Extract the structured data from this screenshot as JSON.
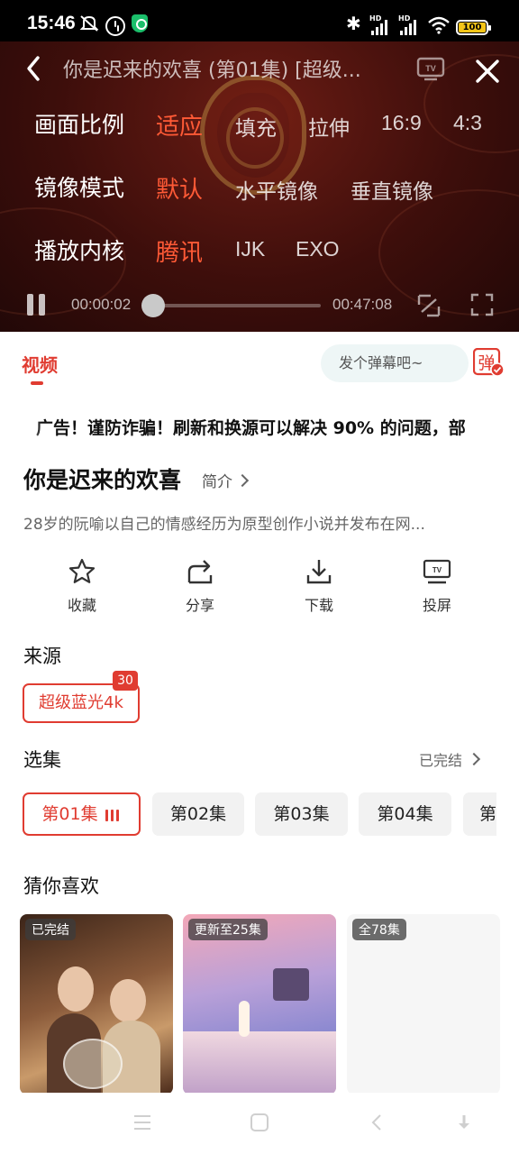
{
  "status_bar": {
    "time": "15:46",
    "battery": "100",
    "icons": [
      "mute-icon",
      "alarm-icon",
      "shield-icon",
      "bluetooth-icon",
      "signal-icon",
      "signal-icon",
      "wifi-icon",
      "battery-icon"
    ],
    "hd_labels": [
      "HD",
      "HD"
    ]
  },
  "player": {
    "title": "你是迟来的欢喜 (第01集) [超级...",
    "settings": {
      "aspect": {
        "label": "画面比例",
        "options": [
          "适应",
          "填充",
          "拉伸",
          "16:9",
          "4:3"
        ],
        "selected": "适应"
      },
      "mirror": {
        "label": "镜像模式",
        "options": [
          "默认",
          "水平镜像",
          "垂直镜像"
        ],
        "selected": "默认"
      },
      "engine": {
        "label": "播放内核",
        "options": [
          "腾讯",
          "IJK",
          "EXO"
        ],
        "selected": "腾讯"
      }
    },
    "current_time": "00:00:02",
    "total_time": "00:47:08",
    "progress": 0.001,
    "icons": [
      "back-icon",
      "tv-icon",
      "close-icon",
      "pause-icon",
      "switch-icon",
      "fullscreen-icon"
    ]
  },
  "tabs": {
    "video": "视频"
  },
  "danmaku": {
    "placeholder": "发个弹幕吧~",
    "button": "弹"
  },
  "notice": "广告！谨防诈骗！刷新和换源可以解决 90% 的问题，部",
  "show": {
    "title": "你是迟来的欢喜",
    "intro_label": "简介",
    "description": "28岁的阮喻以自己的情感经历为原型创作小说并发布在网..."
  },
  "actions": [
    {
      "label": "收藏",
      "icon": "star-icon"
    },
    {
      "label": "分享",
      "icon": "share-icon"
    },
    {
      "label": "下载",
      "icon": "download-icon"
    },
    {
      "label": "投屏",
      "icon": "cast-icon"
    }
  ],
  "source": {
    "title": "来源",
    "selected": "超级蓝光4k",
    "badge": "30"
  },
  "episodes": {
    "title": "选集",
    "status": "已完结",
    "items": [
      "第01集",
      "第02集",
      "第03集",
      "第04集",
      "第"
    ],
    "active_index": 0
  },
  "recommend": {
    "title": "猜你喜欢",
    "cards": [
      {
        "tag": "已完结"
      },
      {
        "tag": "更新至25集"
      },
      {
        "tag": "全78集"
      }
    ]
  },
  "colors": {
    "accent": "#e03c31",
    "highlight": "#ff5a36"
  }
}
